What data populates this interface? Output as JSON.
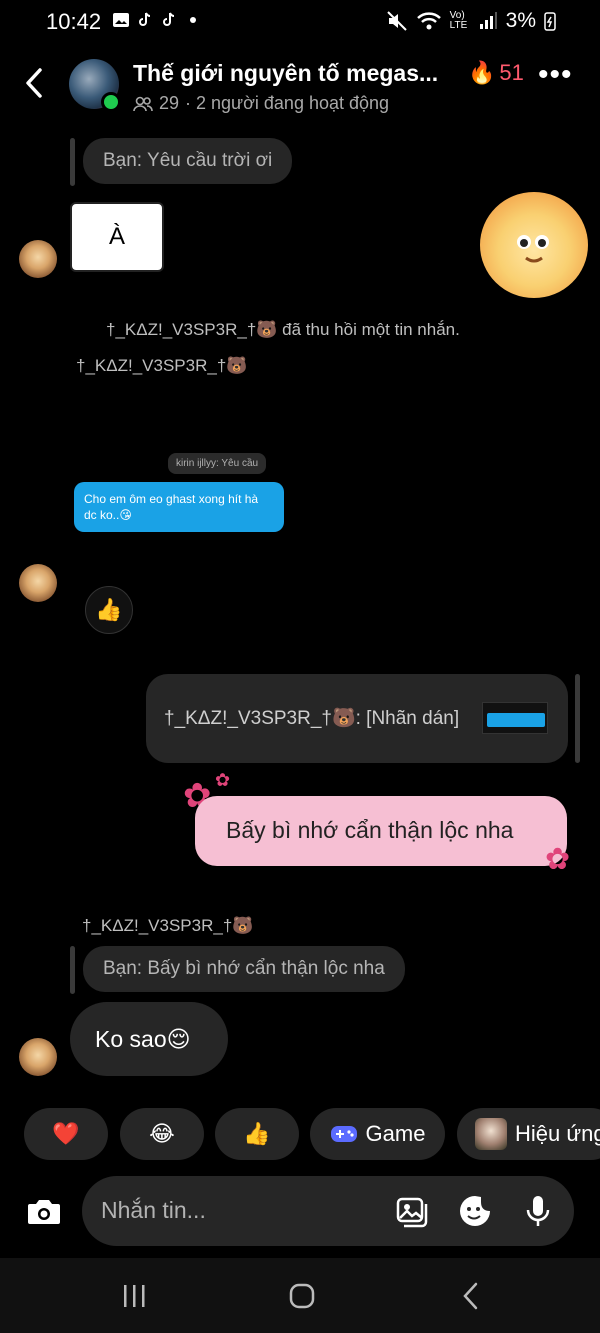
{
  "status_bar": {
    "time": "10:42",
    "battery": "3%",
    "lte_label": "Vo) LTE"
  },
  "header": {
    "title": "Thế giới nguyên tố megas...",
    "streak": "51",
    "member_count": "29",
    "active_text": "· 2 người đang hoạt động"
  },
  "messages": {
    "reply_1": "Bạn: Yêu cầu trời ơi",
    "sticker_text": "À",
    "recalled_notice": "†_KΔZ!_V3SP3R_†🐻 đã thu hồi một tin nhắn.",
    "sender_1": "†_KΔZ!_V3SP3R_†🐻",
    "screenshot_reply": "kirin ijllyy: Yêu cầu",
    "screenshot_bubble": "Cho em ôm eo ghast xong hít hà dc ko..😘",
    "reaction": "👍",
    "quote_text": "†_KΔZ!_V3SP3R_†🐻: [Nhãn dán]",
    "my_message": "Bấy bì nhớ cẩn thận lộc nha",
    "sender_2": "†_KΔZ!_V3SP3R_†🐻",
    "reply_2": "Bạn: Bấy bì nhớ cẩn thận lộc nha",
    "last_message": "Ko sao😌"
  },
  "quick_chips": [
    {
      "icon": "heart-icon",
      "label": "❤️"
    },
    {
      "icon": "laugh-icon",
      "label": "😂"
    },
    {
      "icon": "thumbs-up-icon",
      "label": "👍"
    },
    {
      "icon": "game-icon",
      "label": "Game"
    },
    {
      "icon": "effect-icon",
      "label": "Hiệu ứng"
    }
  ],
  "composer": {
    "placeholder": "Nhắn tin..."
  },
  "colors": {
    "accent_pink": "#f6bfd3",
    "online": "#1fcb4f",
    "streak": "#ff5a6e",
    "game_blue": "#5b6bff"
  }
}
